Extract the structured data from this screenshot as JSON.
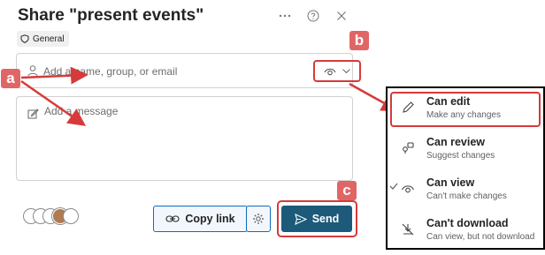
{
  "dialog": {
    "title": "Share \"present events\"",
    "chip_label": "General",
    "icons": [
      "more-icon",
      "help-icon",
      "close-icon"
    ]
  },
  "name_field": {
    "placeholder": "Add a name, group, or email",
    "value": "",
    "permission_icon": "eye-icon"
  },
  "message_field": {
    "placeholder": "Add a message",
    "value": ""
  },
  "footer": {
    "copy_link_label": "Copy link",
    "send_label": "Send"
  },
  "annotations": {
    "a": "a",
    "b": "b",
    "c": "c"
  },
  "permission_menu": {
    "selected": "Can view",
    "items": [
      {
        "label": "Can edit",
        "sub": "Make any changes",
        "icon": "pencil-icon"
      },
      {
        "label": "Can review",
        "sub": "Suggest changes",
        "icon": "review-icon"
      },
      {
        "label": "Can view",
        "sub": "Can't make changes",
        "icon": "eye-icon"
      },
      {
        "label": "Can't download",
        "sub": "Can view, but not download",
        "icon": "no-download-icon"
      }
    ]
  },
  "colors": {
    "annotation": "#d63a3a",
    "send_bg": "#1d5a7a",
    "copy_link_border": "#0f6cbd"
  }
}
